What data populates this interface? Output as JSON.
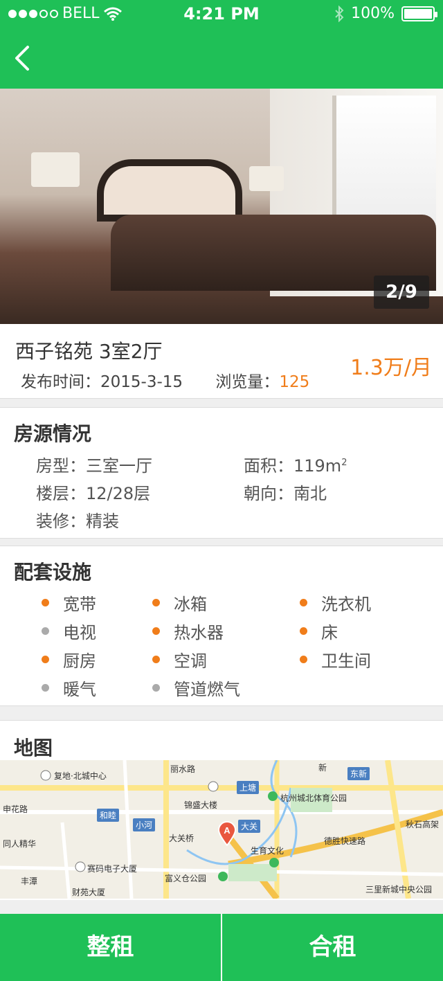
{
  "status_bar": {
    "carrier": "BELL",
    "time": "4:21 PM",
    "battery": "100%",
    "signal_filled": 3,
    "signal_total": 5
  },
  "gallery": {
    "counter": "2/9"
  },
  "listing": {
    "title": "西子铭苑 3室2厅",
    "publish_label": "发布时间：",
    "publish_date": "2015-3-15",
    "views_label": "浏览量：",
    "views": "125",
    "price": "1.3万/月"
  },
  "house_info": {
    "title": "房源情况",
    "layout_label": "房型：",
    "layout": "三室一厅",
    "area_label": "面积：",
    "area": "119m",
    "area_unit_sup": "2",
    "floor_label": "楼层：",
    "floor": "12/28层",
    "orientation_label": "朝向：",
    "orientation": "南北",
    "decoration_label": "装修：",
    "decoration": "精装"
  },
  "facilities": {
    "title": "配套设施",
    "items": [
      {
        "label": "宽带",
        "available": true
      },
      {
        "label": "冰箱",
        "available": true
      },
      {
        "label": "洗衣机",
        "available": true
      },
      {
        "label": "电视",
        "available": false
      },
      {
        "label": "热水器",
        "available": true
      },
      {
        "label": "床",
        "available": true
      },
      {
        "label": "厨房",
        "available": true
      },
      {
        "label": "空调",
        "available": true
      },
      {
        "label": "卫生间",
        "available": true
      },
      {
        "label": "暖气",
        "available": false
      },
      {
        "label": "管道燃气",
        "available": false
      }
    ]
  },
  "map": {
    "title": "地图",
    "labels": [
      "复地·北城中心",
      "锦盛大楼",
      "杭州城北体育公园",
      "和睦",
      "小河",
      "大关桥",
      "大关",
      "上塘",
      "东新",
      "生育文化",
      "同人精华",
      "赛码电子大厦",
      "富义仓公园",
      "财苑大厦",
      "三里新城中央公园",
      "德胜快速路",
      "申花路",
      "秋石高架",
      "丰潭",
      "丽水路",
      "新"
    ],
    "marker": "A"
  },
  "actions": {
    "whole_rent": "整租",
    "shared_rent": "合租"
  },
  "colors": {
    "primary": "#1fc057",
    "accent": "#f07d1a",
    "inactive": "#aaaaaa"
  }
}
